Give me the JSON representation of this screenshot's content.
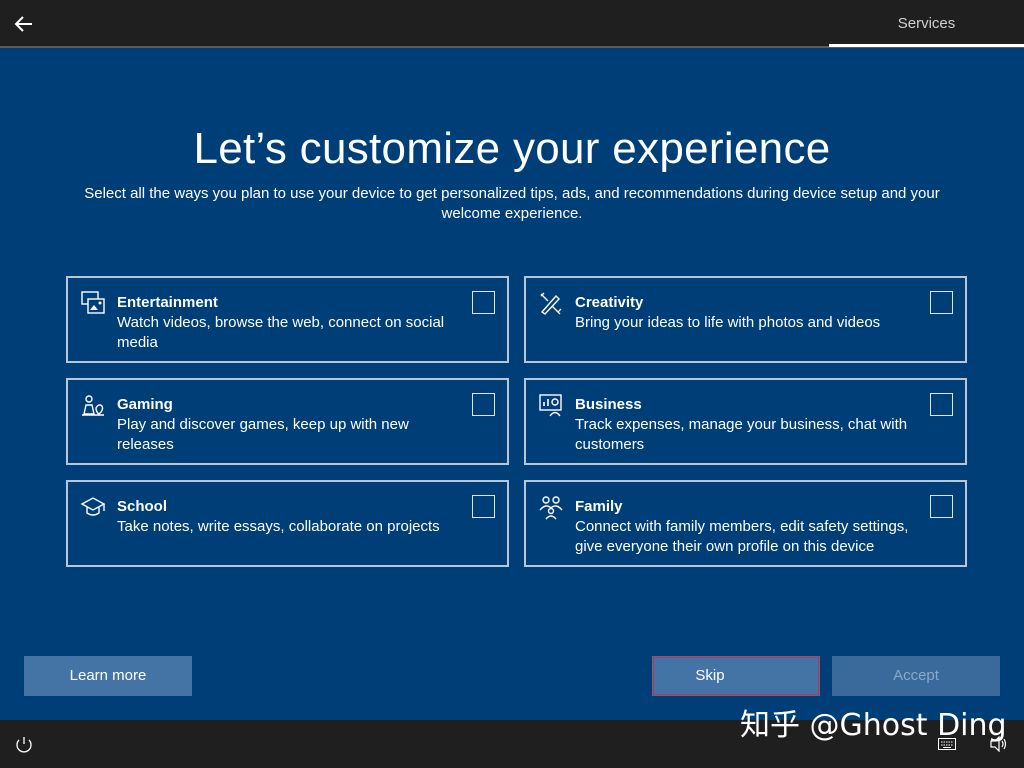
{
  "header": {
    "tab_label": "Services"
  },
  "main": {
    "title": "Let’s customize your experience",
    "subtitle": "Select all the ways you plan to use your device to get personalized tips, ads, and recommendations during device setup and your welcome experience."
  },
  "options": [
    {
      "title": "Entertainment",
      "desc": "Watch videos, browse the web, connect on social media",
      "icon": "entertainment-icon",
      "checked": false
    },
    {
      "title": "Creativity",
      "desc": "Bring your ideas to life with photos and videos",
      "icon": "creativity-icon",
      "checked": false
    },
    {
      "title": "Gaming",
      "desc": "Play and discover games, keep up with new releases",
      "icon": "gaming-icon",
      "checked": false
    },
    {
      "title": "Business",
      "desc": "Track expenses, manage your business, chat with customers",
      "icon": "business-icon",
      "checked": false
    },
    {
      "title": "School",
      "desc": "Take notes, write essays, collaborate on projects",
      "icon": "school-icon",
      "checked": false
    },
    {
      "title": "Family",
      "desc": "Connect with family members, edit safety settings, give everyone their own profile on this device",
      "icon": "family-icon",
      "checked": false
    }
  ],
  "footer": {
    "learn_more": "Learn more",
    "skip": "Skip",
    "accept": "Accept"
  },
  "watermark": "知乎 @Ghost Ding",
  "colors": {
    "background": "#003e78",
    "button": "#4374a5",
    "topbar": "#1f1f1f"
  }
}
